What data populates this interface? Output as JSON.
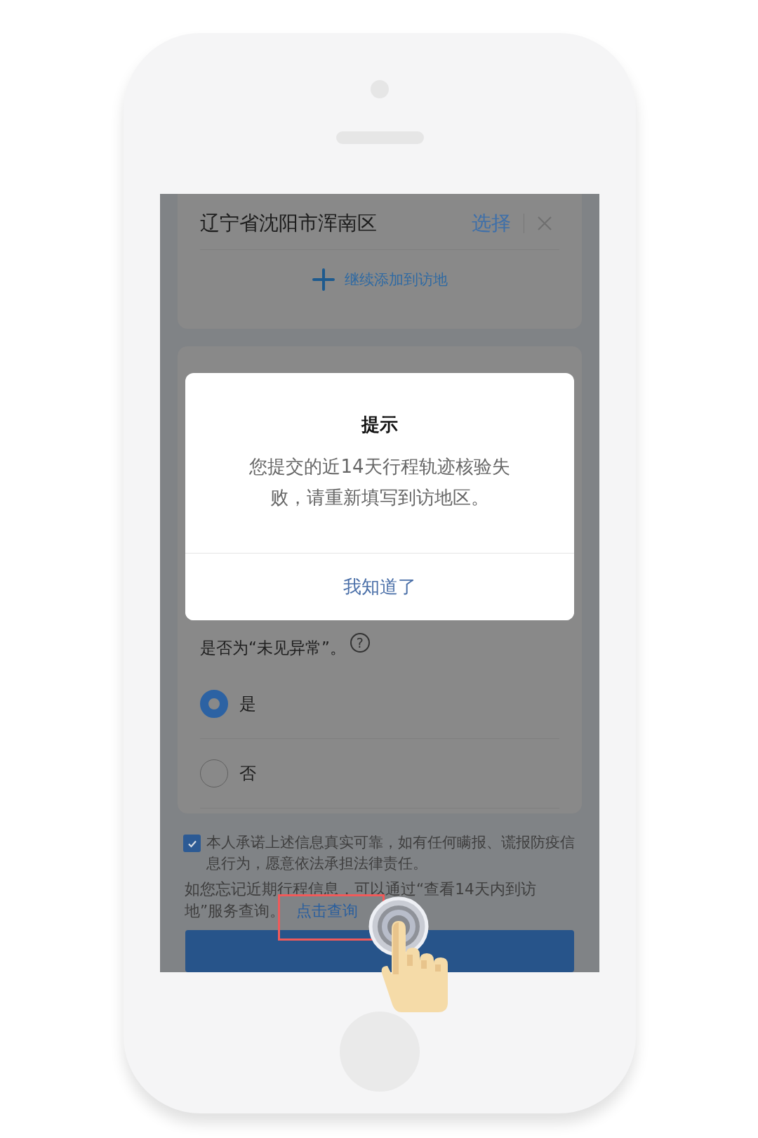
{
  "screen": {
    "location": {
      "value": "辽宁省沈阳市浑南区",
      "action": "选择"
    },
    "add_link": {
      "label": "继续添加到访地"
    },
    "question": {
      "text": "是否为“未见异常”。",
      "help": "?"
    },
    "options": [
      {
        "label": "是",
        "selected": true
      },
      {
        "label": "否",
        "selected": false
      }
    ],
    "pledge": {
      "checked": true,
      "text": "本人承诺上述信息真实可靠，如有任何瞒报、谎报防疫信息行为，愿意依法承担法律责任。"
    },
    "hint": {
      "text": "如您忘记近期行程信息，可以通过“查看14天内到访地”服务查询。",
      "link": "点击查询"
    }
  },
  "dialog": {
    "title": "提示",
    "message": "您提交的近14天行程轨迹核验失败，请重新填写到访地区。",
    "button": "我知道了"
  }
}
